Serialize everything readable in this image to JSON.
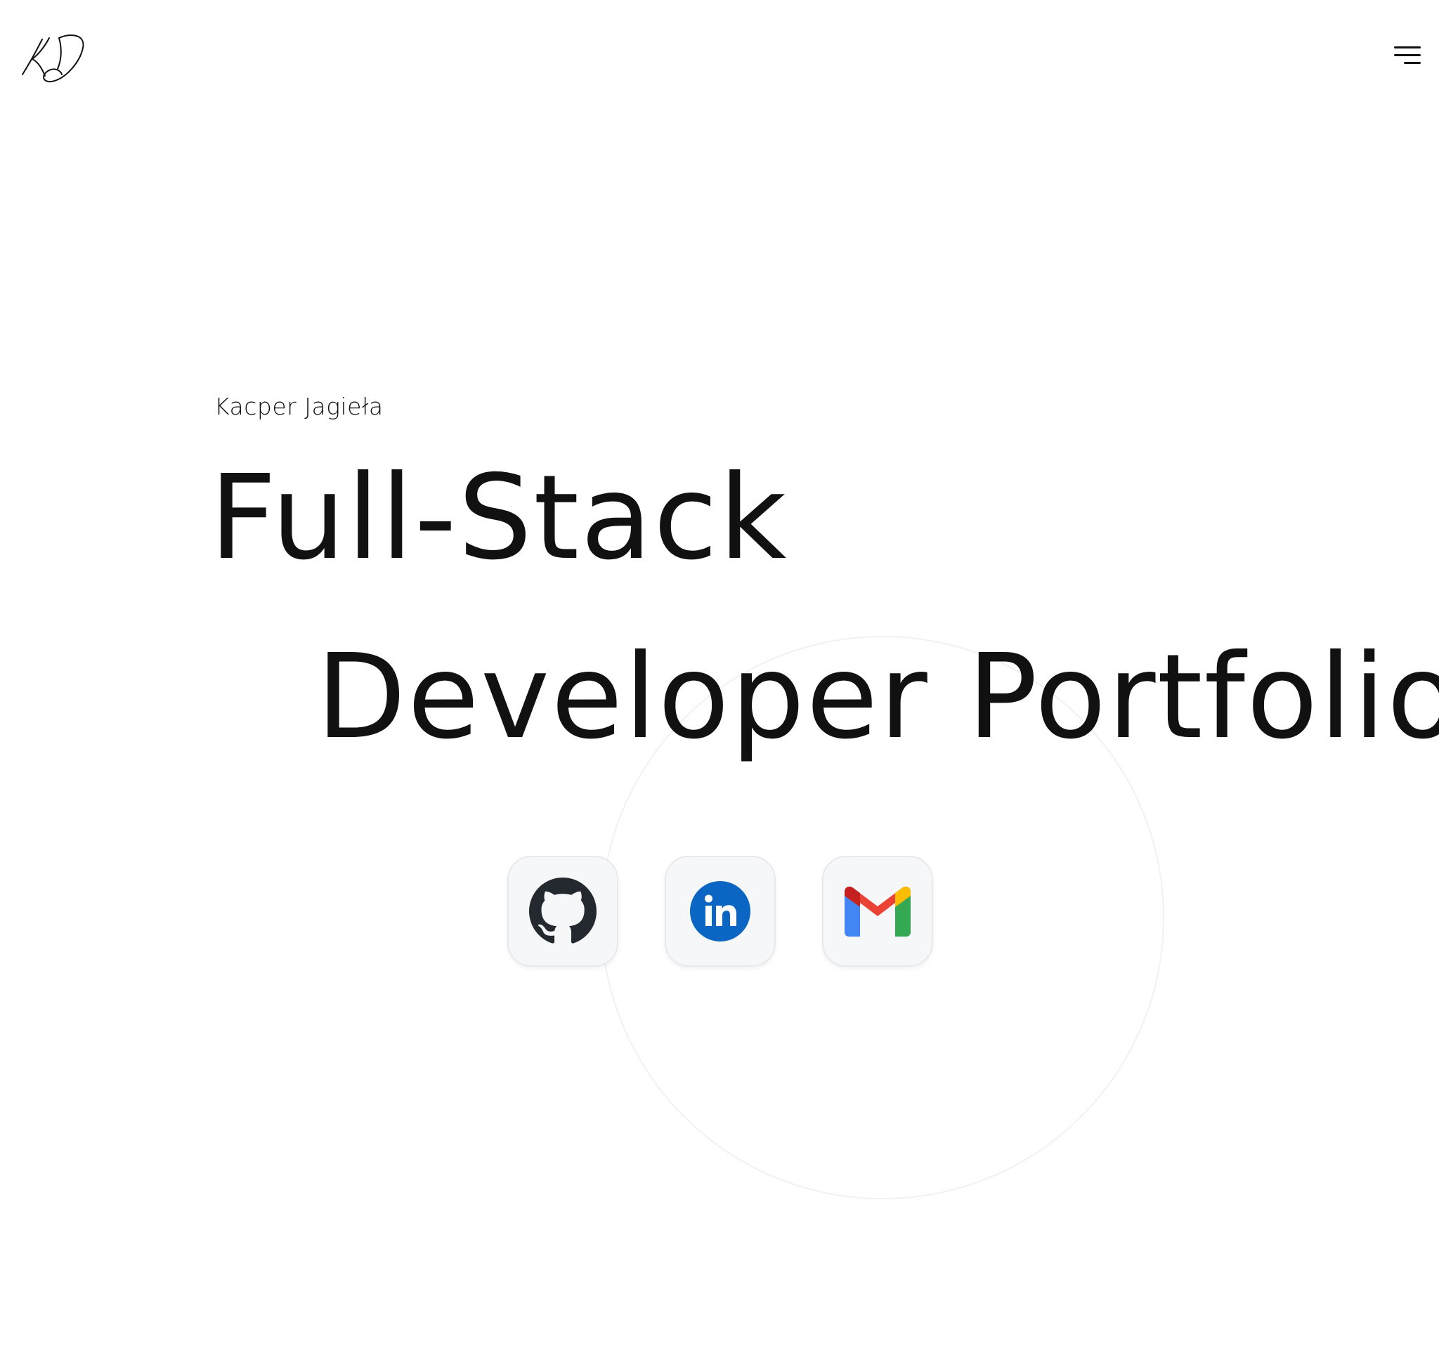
{
  "header": {
    "logo_icon": "kj-signature-logo-icon",
    "menu_icon": "hamburger-menu-icon"
  },
  "hero": {
    "name": "Kacper Jagieła",
    "headline_line1": "Full-Stack",
    "headline_line2": "Developer Portfolio"
  },
  "socials": [
    {
      "icon": "github-icon",
      "color": "#24292f"
    },
    {
      "icon": "linkedin-icon",
      "color": "#0a66c2"
    },
    {
      "icon": "gmail-icon",
      "colors": [
        "#ea4335",
        "#4285f4",
        "#34a853",
        "#fbbc04",
        "#c5221f"
      ]
    }
  ],
  "colors": {
    "background": "#ffffff",
    "text": "#111111",
    "tile_background": "#f6f7f9",
    "circle_outline": "#f1f1f1"
  }
}
